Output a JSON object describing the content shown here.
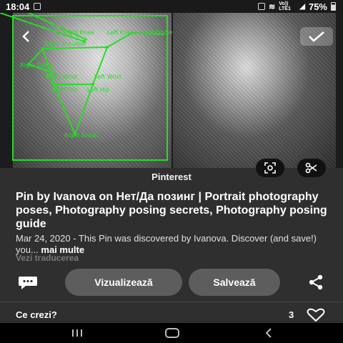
{
  "status_bar": {
    "time": "18:04",
    "battery": "75%",
    "vo_label": "Vo)) LTE1"
  },
  "image": {
    "pose_labels": [
      "Right Knee",
      "Left Knee",
      "Right Shoulder",
      "Left Elbow",
      "Right Elbow",
      "Right Wrist",
      "Left Wrist",
      "Right Hip",
      "Left Hip",
      "Right Ankle"
    ],
    "back_icon": "chevron-left-icon",
    "select_icon": "checkmark-icon",
    "lens_icon": "visual-search-icon",
    "cut_icon": "scissors-icon"
  },
  "pin": {
    "source": "Pinterest",
    "title": "Pin by Ivanova on Нет/Да  позинг | Portrait photography poses, Photography posing secrets, Photography posing guide",
    "description": "Mar 24, 2020 - This Pin was discovered by Ivanova. Discover (and save!) you...",
    "more_label": "mai multe",
    "translate_label": "Vezi traducerea"
  },
  "actions": {
    "visit_label": "Vizualizează",
    "save_label": "Salvează",
    "comment_icon": "comment-bubble-icon",
    "share_icon": "share-icon"
  },
  "comments": {
    "prompt": "Ce crezi?",
    "likes": "3"
  },
  "colors": {
    "background": "#2f2f30",
    "pill": "#5d5d5d",
    "pose_overlay": "#22e022",
    "muted_text": "#7a7a7a"
  }
}
